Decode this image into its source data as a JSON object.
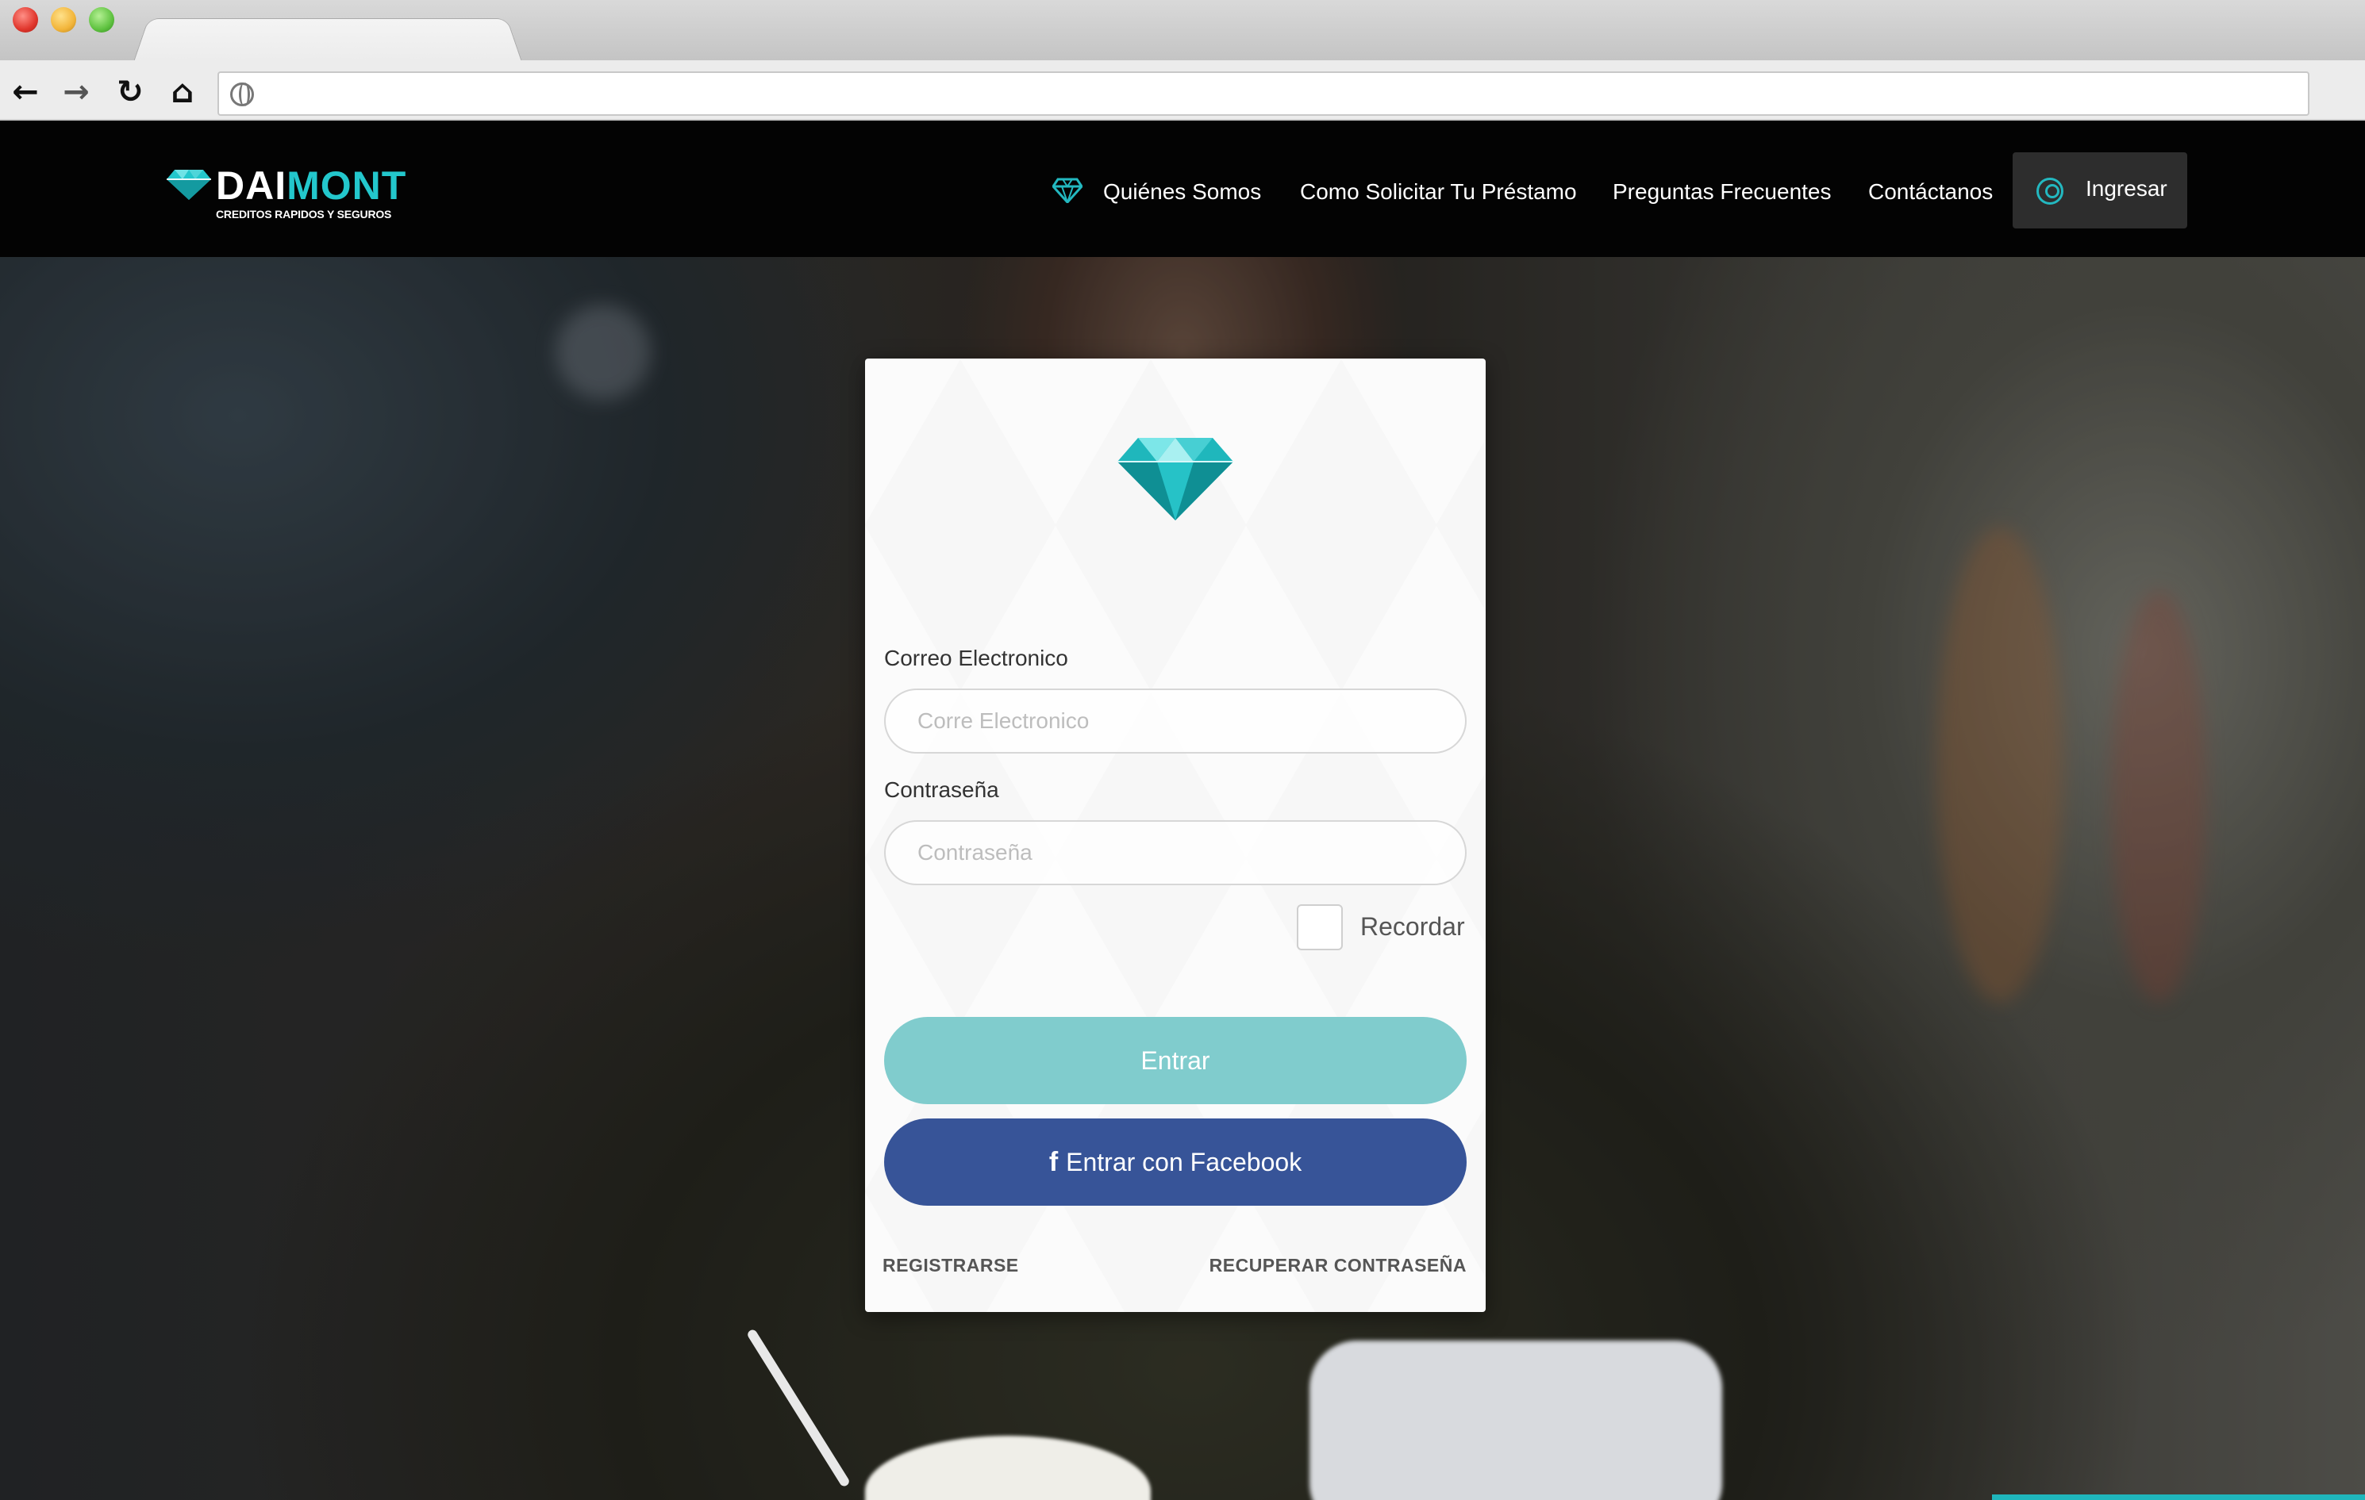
{
  "browser": {
    "address": "",
    "nav_icons": [
      "back-arrow-icon",
      "forward-arrow-icon",
      "reload-icon",
      "home-icon",
      "globe-icon"
    ]
  },
  "header": {
    "logo": {
      "word_part1": "DAI",
      "word_part2": "MONT",
      "tagline": "CREDITOS RAPIDOS Y SEGUROS"
    },
    "nav": [
      {
        "label": "Quiénes Somos"
      },
      {
        "label": "Como Solicitar Tu Préstamo"
      },
      {
        "label": "Preguntas Frecuentes"
      },
      {
        "label": "Contáctanos"
      }
    ],
    "login_button": "Ingresar"
  },
  "login_form": {
    "email_label": "Correo Electronico",
    "email_placeholder": "Corre Electronico",
    "email_value": "",
    "password_label": "Contraseña",
    "password_placeholder": "Contraseña",
    "password_value": "",
    "remember_label": "Recordar",
    "remember_checked": false,
    "submit_label": "Entrar",
    "facebook_icon_glyph": "f",
    "facebook_label": "Entrar con Facebook",
    "register_link": "REGISTRARSE",
    "recover_link": "RECUPERAR CONTRASEÑA"
  },
  "colors": {
    "brand_teal": "#23c7cc",
    "enter_button": "#80cccd",
    "facebook_button": "#375498",
    "header_bg": "#030303"
  }
}
